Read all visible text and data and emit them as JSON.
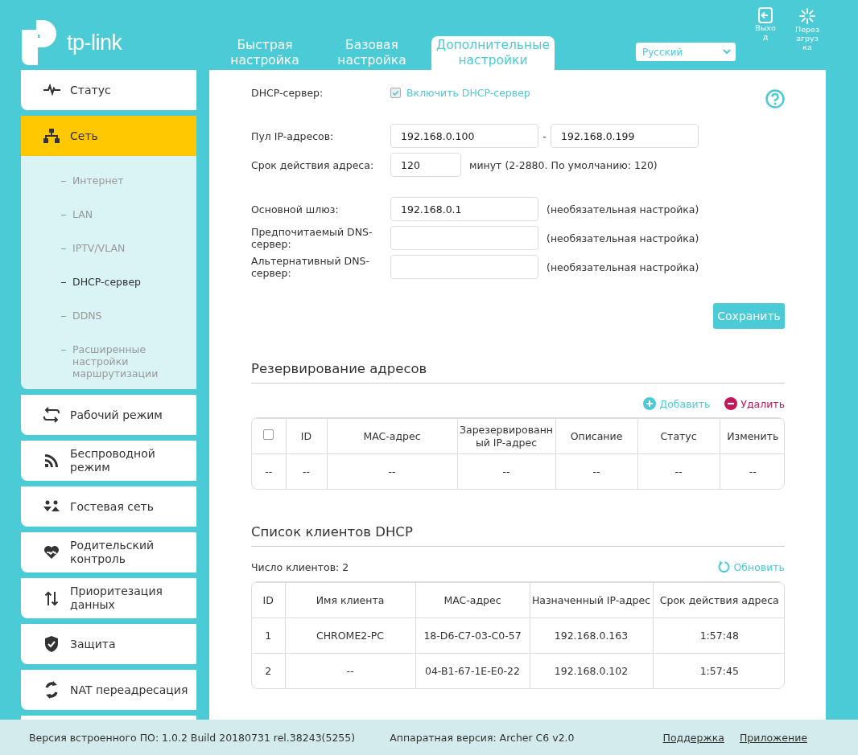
{
  "header": {
    "logo": "tp-link",
    "tabs": [
      {
        "label": "Быстрая настройка",
        "selected": false
      },
      {
        "label": "Базовая настройка",
        "selected": false
      },
      {
        "label": "Дополнительные настройки",
        "selected": true
      }
    ],
    "language": "Русский",
    "actions": [
      {
        "kind": "logout",
        "label": "Выход"
      },
      {
        "kind": "reboot",
        "label": "Перезагрузка"
      }
    ]
  },
  "sidebar": {
    "items": [
      {
        "label": "Статус",
        "selected": false
      },
      {
        "label": "Сеть",
        "selected": true,
        "expanded": true,
        "children": [
          {
            "label": "Интернет",
            "selected": false
          },
          {
            "label": "LAN",
            "selected": false
          },
          {
            "label": "IPTV/VLAN",
            "selected": false
          },
          {
            "label": "DHCP-сервер",
            "selected": true
          },
          {
            "label": "DDNS",
            "selected": false
          },
          {
            "label": "Расширенные настройки маршрутизации",
            "selected": false
          }
        ]
      },
      {
        "label": "Рабочий режим",
        "selected": false
      },
      {
        "label": "Беспроводной режим",
        "selected": false
      },
      {
        "label": "Гостевая сеть",
        "selected": false
      },
      {
        "label": "Родительский контроль",
        "selected": false
      },
      {
        "label": "Приоритезация данных",
        "selected": false
      },
      {
        "label": "Защита",
        "selected": false
      },
      {
        "label": "NAT переадресация",
        "selected": false
      }
    ]
  },
  "dhcp": {
    "label": "DHCP-сервер:",
    "enable": {
      "label": "Включить DHCP-сервер",
      "checked": true
    },
    "groups": [
      [
        {
          "kind": "range",
          "label": "Пул IP-адресов:",
          "values": [
            "192.168.0.100",
            "192.168.0.199"
          ],
          "separator": "-"
        },
        {
          "kind": "short",
          "label": "Срок действия адреса:",
          "value": "120",
          "note": "минут (2-2880. По умолчанию: 120)"
        }
      ],
      [
        {
          "kind": "text",
          "label": "Основной шлюз:",
          "value": "192.168.0.1",
          "note": "(необязательная настройка)"
        },
        {
          "kind": "text",
          "label": "Предпочитаемый DNS-сервер:",
          "note": "(необязательная настройка)"
        },
        {
          "kind": "text",
          "label": "Альтернативный DNS-сервер:",
          "note": "(необязательная настройка)"
        }
      ]
    ],
    "save": "Сохранить"
  },
  "reservation": {
    "title": "Резервирование адресов",
    "actions": [
      {
        "kind": "add",
        "label": "Добавить"
      },
      {
        "kind": "delete",
        "label": "Удалить"
      }
    ],
    "select_all": {
      "checked": false
    },
    "columns": [
      "",
      "ID",
      "MAC-адрес",
      "Зарезервированный IP-адрес",
      "Описание",
      "Статус",
      "Изменить"
    ],
    "rows": [
      [
        "--",
        "--",
        "--",
        "--",
        "--",
        "--",
        "--"
      ]
    ]
  },
  "clients": {
    "title": "Список клиентов DHCP",
    "count": "Число клиентов: 2",
    "refresh": "Обновить",
    "columns": [
      "ID",
      "Имя клиента",
      "MAC-адрес",
      "Назначенный IP-адрес",
      "Срок действия адреса"
    ],
    "rows": [
      [
        "1",
        "CHROME2-PC",
        "18-D6-C7-03-C0-57",
        "192.168.0.163",
        "1:57:48"
      ],
      [
        "2",
        "--",
        "04-B1-67-1E-E0-22",
        "192.168.0.102",
        "1:57:45"
      ]
    ]
  },
  "footer": {
    "firmware": "Версия встроенного ПО: 1.0.2 Build 20180731 rel.38243(5255)",
    "hardware": "Аппаратная версия: Archer C6 v2.0",
    "links": [
      "Поддержка",
      "Приложение"
    ]
  }
}
